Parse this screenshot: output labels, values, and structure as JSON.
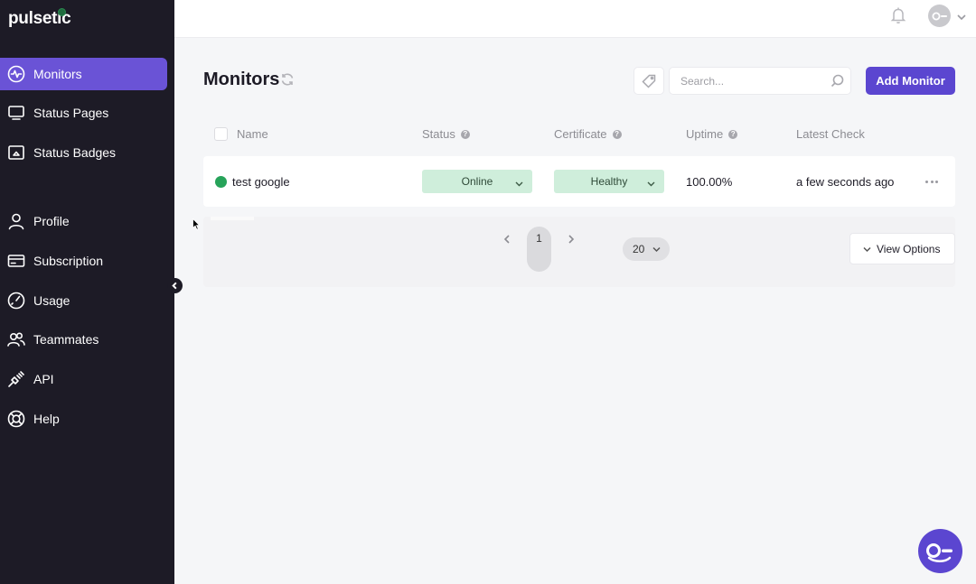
{
  "app": {
    "logo_text": "pulsetic"
  },
  "sidebar": {
    "items": [
      {
        "label": "Monitors",
        "icon": "monitor-pulse-icon",
        "active": true
      },
      {
        "label": "Status Pages",
        "icon": "screen-icon"
      },
      {
        "label": "Status Badges",
        "icon": "badge-image-icon"
      },
      {
        "label": "Profile",
        "icon": "user-icon"
      },
      {
        "label": "Subscription",
        "icon": "credit-card-icon"
      },
      {
        "label": "Usage",
        "icon": "gauge-icon"
      },
      {
        "label": "Teammates",
        "icon": "users-icon"
      },
      {
        "label": "API",
        "icon": "plug-icon"
      },
      {
        "label": "Help",
        "icon": "lifebuoy-icon"
      }
    ]
  },
  "header": {
    "title": "Monitors",
    "search_placeholder": "Search...",
    "add_button": "Add Monitor"
  },
  "table": {
    "columns": [
      "Name",
      "Status",
      "Certificate",
      "Uptime",
      "Latest Check"
    ],
    "rows": [
      {
        "name": "test google",
        "status": "Online",
        "certificate": "Healthy",
        "uptime": "100.00%",
        "latest_check": "a few seconds ago",
        "status_color": "#27a35a"
      }
    ]
  },
  "pagination": {
    "current_page": "1",
    "page_size": "20",
    "view_options": "View Options"
  },
  "colors": {
    "accent": "#5b46d0",
    "sidebar_bg": "#1d1b26",
    "online": "#27a35a",
    "pill_bg": "#cfeedb"
  }
}
